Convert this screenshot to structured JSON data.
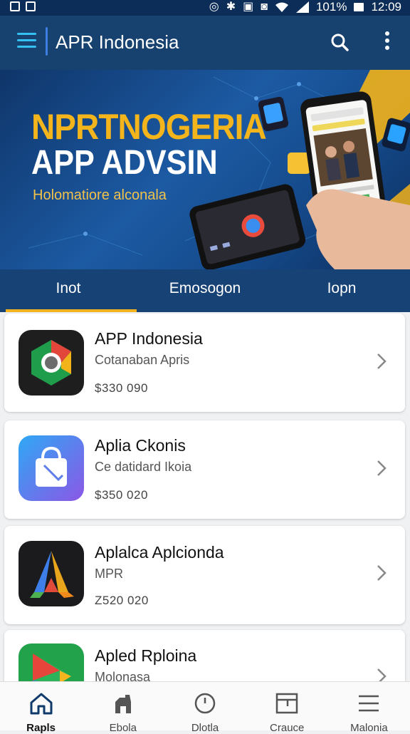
{
  "status_bar": {
    "battery": "101%",
    "time": "12:09"
  },
  "app_bar": {
    "title": "APR Indonesia"
  },
  "banner": {
    "title": "NPRTNOGERIA",
    "subtitle": "APP ADVSIN",
    "tagline": "Holomatiore alconala"
  },
  "tabs": [
    {
      "label": "Inot",
      "active": true
    },
    {
      "label": "Emosogon",
      "active": false
    },
    {
      "label": "Iopn",
      "active": false
    }
  ],
  "apps": [
    {
      "name": "APP Indonesia",
      "subtitle": "Cotanaban Apris",
      "price": "$330 090",
      "icon": "chrome-like-icon"
    },
    {
      "name": "Aplia Ckonis",
      "subtitle": "Ce datidard Ikoia",
      "price": "$350 020",
      "icon": "shopping-bag-icon"
    },
    {
      "name": "Aplalca Aplcionda",
      "subtitle": "MPR",
      "price": "Z520 020",
      "icon": "triangle-a-icon"
    },
    {
      "name": "Apled Rploina",
      "subtitle": "Molonasa",
      "price": "",
      "icon": "play-store-icon"
    }
  ],
  "bottom_nav": [
    {
      "label": "Rapls",
      "icon": "home-icon",
      "active": true
    },
    {
      "label": "Ebola",
      "icon": "store-icon",
      "active": false
    },
    {
      "label": "Dlotla",
      "icon": "clock-icon",
      "active": false
    },
    {
      "label": "Crauce",
      "icon": "folder-icon",
      "active": false
    },
    {
      "label": "Malonia",
      "icon": "menu-lines-icon",
      "active": false
    }
  ],
  "colors": {
    "app_bar": "#17416f",
    "accent": "#f1b320",
    "menu_accent": "#34c0f0"
  }
}
